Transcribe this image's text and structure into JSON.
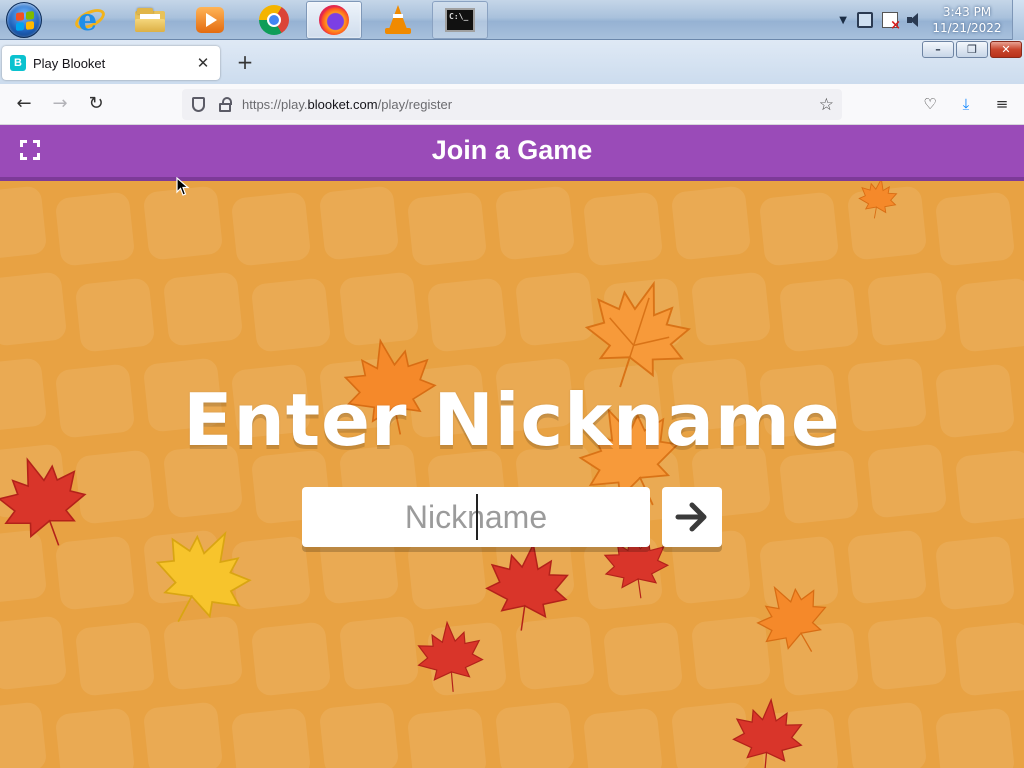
{
  "taskbar": {
    "apps": [
      "start-menu",
      "internet-explorer",
      "file-explorer",
      "media-player",
      "google-chrome",
      "firefox",
      "vlc",
      "command-prompt"
    ],
    "active_app": "firefox",
    "clock": {
      "time": "3:43 PM",
      "date": "11/21/2022"
    },
    "tray_icons": [
      "show-hidden-chevron",
      "network-icon",
      "action-center-flag-icon",
      "speaker-icon"
    ]
  },
  "window": {
    "controls": {
      "minimize": "–",
      "restore": "❐",
      "close": "✕"
    }
  },
  "browser": {
    "tab": {
      "favicon": "B",
      "title": "Play Blooket",
      "close": "✕"
    },
    "new_tab": "+",
    "nav": {
      "back": "←",
      "forward": "→",
      "reload": "↻"
    },
    "url": {
      "prefix": "https://play.",
      "host": "blooket.com",
      "path": "/play/register"
    },
    "bookmark_star": "☆",
    "toolbar": {
      "pocket": "♡",
      "downloads": "⤓",
      "menu": "≡"
    }
  },
  "page": {
    "header_title": "Join a Game",
    "heading": "Enter Nickname",
    "nickname_input": {
      "value": "",
      "placeholder": "Nickname"
    },
    "submit_icon": "arrow-right-icon"
  },
  "colors": {
    "header_purple": "#9a4bb8",
    "background_orange": "#e8a243",
    "leaf_red": "#d9352a",
    "leaf_orange": "#f5892a",
    "leaf_yellow": "#f7c42c"
  }
}
